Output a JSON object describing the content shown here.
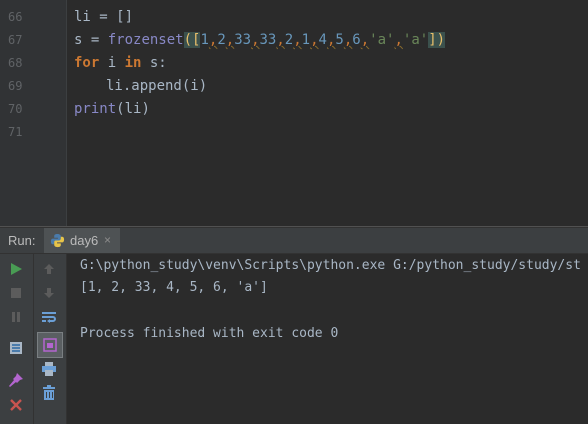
{
  "editor": {
    "line_numbers": [
      "66",
      "67",
      "68",
      "69",
      "70",
      "71"
    ],
    "line66": {
      "var": "li",
      "op": " = ",
      "brackets": "[]"
    },
    "line67": {
      "var": "s",
      "op": " = ",
      "func": "frozenset",
      "open": "([",
      "n1": "1",
      "n2": "2",
      "n3": "33",
      "n4": "33",
      "n5": "2",
      "n6": "1",
      "n7": "4",
      "n8": "5",
      "n9": "6",
      "s1": "'a'",
      "s2": "'a'",
      "comma": ",",
      "close": "])"
    },
    "line68": {
      "kw_for": "for",
      "var_i": " i ",
      "kw_in": "in",
      "rest": " s:"
    },
    "line69": {
      "text": "li.append(i)"
    },
    "line70": {
      "func": "print",
      "args": "(li)"
    }
  },
  "run_panel": {
    "label": "Run:",
    "tab_name": "day6",
    "tab_close": "×"
  },
  "console": {
    "lines": [
      "G:\\python_study\\venv\\Scripts\\python.exe G:/python_study/study/st",
      "[1, 2, 33, 4, 5, 6, 'a']",
      "",
      "Process finished with exit code 0"
    ]
  },
  "colors": {
    "keyword": "#cc7832",
    "builtin": "#8888c6",
    "number": "#6897bb",
    "string": "#6a8759",
    "text": "#a9b7c6",
    "run_green": "#499c54",
    "close_red": "#c75450"
  }
}
